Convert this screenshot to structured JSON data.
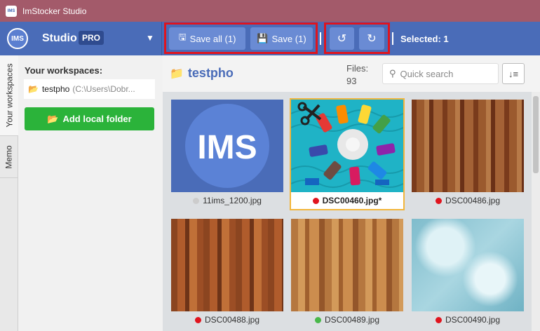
{
  "window": {
    "title": "ImStocker Studio",
    "app_icon": "IMS"
  },
  "toolbar": {
    "logo": "IMS",
    "studio_label": "Studio",
    "pro_badge": "PRO",
    "save_all_label": "Save all (1)",
    "save_label": "Save (1)",
    "selected_text": "Selected: 1",
    "highlight_color": "#e0141e"
  },
  "sidebar": {
    "tabs": [
      {
        "label": "Your workspaces"
      },
      {
        "label": "Memo"
      }
    ],
    "heading": "Your workspaces:",
    "workspace": {
      "name": "testpho",
      "path": "(C:\\Users\\Dobr..."
    },
    "add_button": "Add local folder",
    "add_button_color": "#2bb33a"
  },
  "main": {
    "folder_name": "testpho",
    "files_label": "Files:",
    "files_count": "93",
    "search_placeholder": "Quick search",
    "files": [
      {
        "name": "11ims_1200.jpg",
        "status_color": "#cccccc",
        "thumb": "ims-logo",
        "logo_text": "IMS"
      },
      {
        "name": "DSC00460.jpg*",
        "status_color": "#e0141e",
        "thumb": "sewing-threads",
        "selected": true
      },
      {
        "name": "DSC00486.jpg",
        "status_color": "#e0141e",
        "thumb": "wood"
      },
      {
        "name": "DSC00488.jpg",
        "status_color": "#e0141e",
        "thumb": "wood"
      },
      {
        "name": "DSC00489.jpg",
        "status_color": "#49b84a",
        "thumb": "wood"
      },
      {
        "name": "DSC00490.jpg",
        "status_color": "#e0141e",
        "thumb": "ice-texture"
      }
    ]
  }
}
